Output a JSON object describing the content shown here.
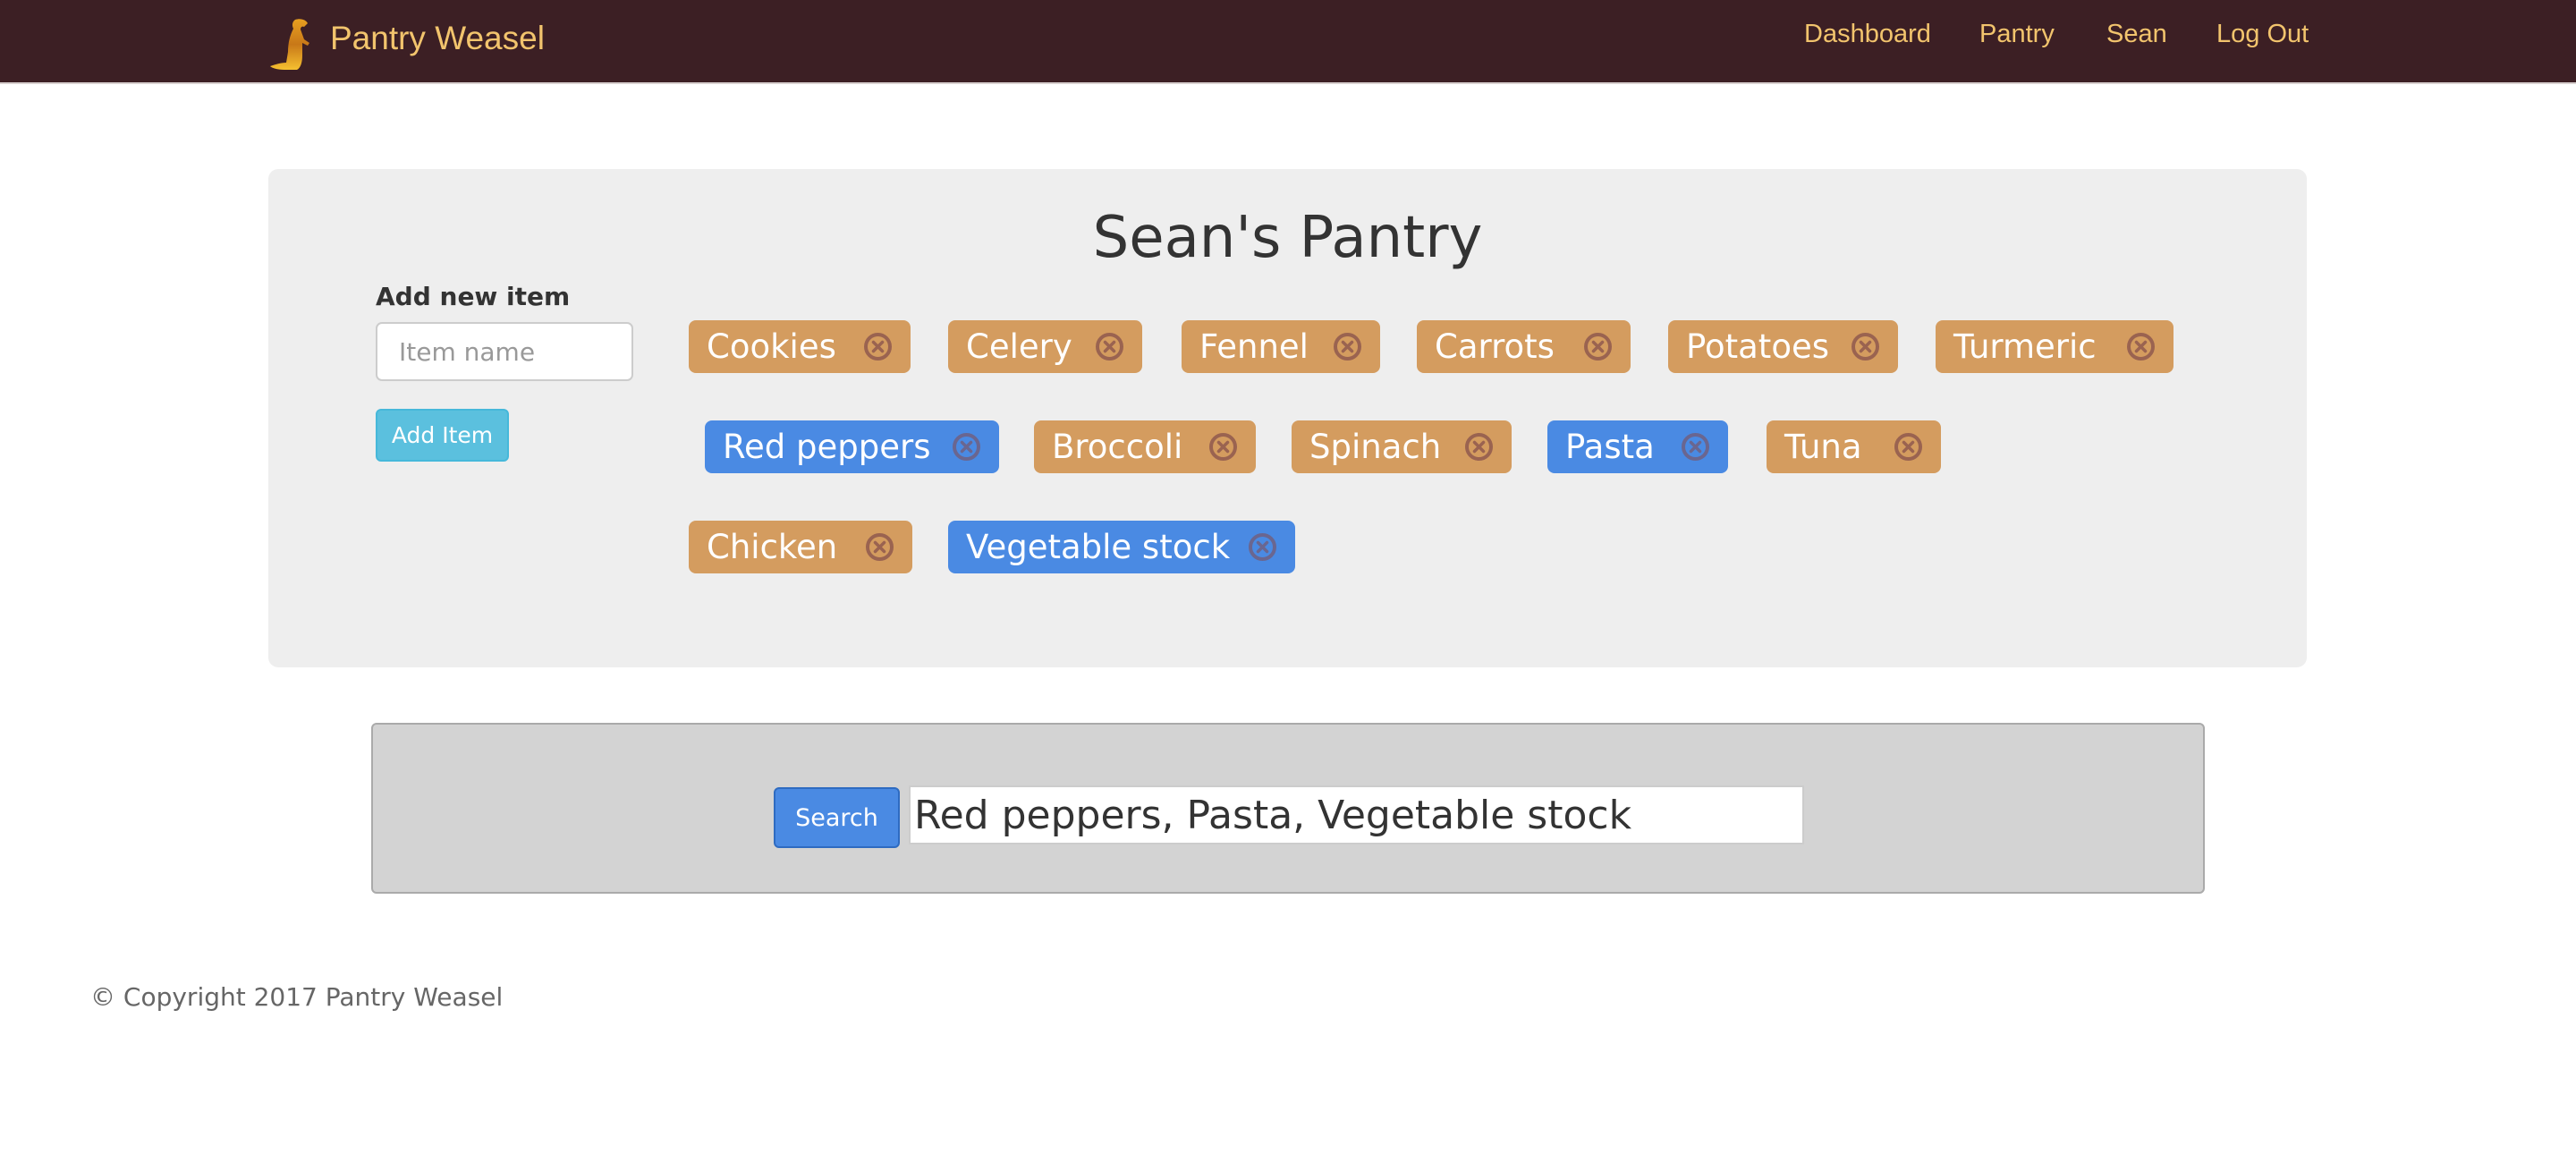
{
  "navbar": {
    "brand": "Pantry Weasel",
    "brand_icon": "weasel-logo-icon",
    "links": [
      {
        "label": "Dashboard"
      },
      {
        "label": "Pantry"
      },
      {
        "label": "Sean"
      },
      {
        "label": "Log Out"
      }
    ]
  },
  "pantry": {
    "title": "Sean's Pantry",
    "add_label": "Add new item",
    "input_placeholder": "Item name",
    "input_value": "",
    "add_button": "Add Item",
    "items": [
      {
        "name": "Cookies",
        "selected": false
      },
      {
        "name": "Celery",
        "selected": false
      },
      {
        "name": "Fennel",
        "selected": false
      },
      {
        "name": "Carrots",
        "selected": false
      },
      {
        "name": "Potatoes",
        "selected": false
      },
      {
        "name": "Turmeric",
        "selected": false
      },
      {
        "name": "Red peppers",
        "selected": true
      },
      {
        "name": "Broccoli",
        "selected": false
      },
      {
        "name": "Spinach",
        "selected": false
      },
      {
        "name": "Pasta",
        "selected": true
      },
      {
        "name": "Tuna",
        "selected": false
      },
      {
        "name": "Chicken",
        "selected": false
      },
      {
        "name": "Vegetable stock",
        "selected": true
      }
    ],
    "remove_icon": "circle-x-icon"
  },
  "search": {
    "button": "Search",
    "value": "Red peppers, Pasta, Vegetable stock"
  },
  "footer": {
    "text": "© Copyright 2017 Pantry Weasel"
  },
  "colors": {
    "navbar_bg": "#3c1f24",
    "nav_text": "#f2c46d",
    "tag_unselected": "#d49c5f",
    "tag_selected": "#4a8ae3",
    "add_button": "#5bc0de",
    "search_button": "#4a8ae3"
  }
}
